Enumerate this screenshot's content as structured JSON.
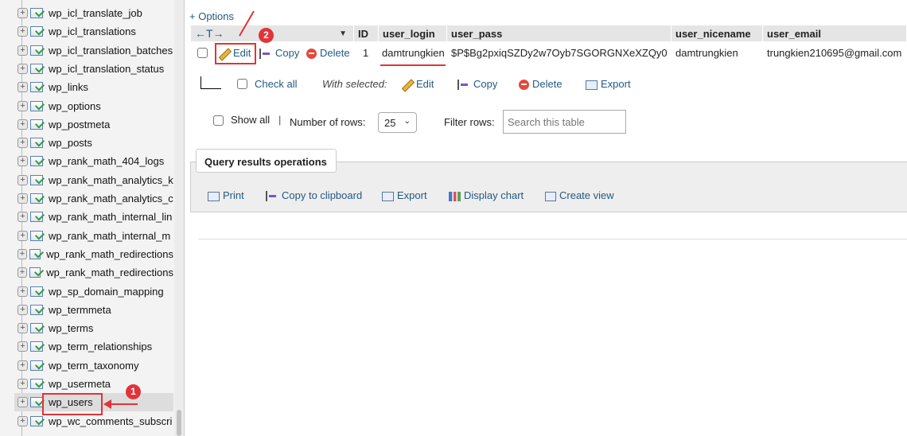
{
  "sidebar": {
    "items": [
      "wp_icl_translate_job",
      "wp_icl_translations",
      "wp_icl_translation_batches",
      "wp_icl_translation_status",
      "wp_links",
      "wp_options",
      "wp_postmeta",
      "wp_posts",
      "wp_rank_math_404_logs",
      "wp_rank_math_analytics_k",
      "wp_rank_math_analytics_c",
      "wp_rank_math_internal_lin",
      "wp_rank_math_internal_m",
      "wp_rank_math_redirections",
      "wp_rank_math_redirections",
      "wp_sp_domain_mapping",
      "wp_termmeta",
      "wp_terms",
      "wp_term_relationships",
      "wp_term_taxonomy",
      "wp_usermeta",
      "wp_users",
      "wp_wc_comments_subscri"
    ],
    "active": "wp_users"
  },
  "options_label": "+ Options",
  "table": {
    "columns": [
      "ID",
      "user_login",
      "user_pass",
      "user_nicename",
      "user_email"
    ],
    "rows": [
      {
        "edit": "Edit",
        "copy": "Copy",
        "delete": "Delete",
        "ID": "1",
        "user_login": "damtrungkien",
        "user_pass": "$P$Bg2pxiqSZDy2w7Oyb7SGORGNXeXZQy0",
        "user_nicename": "damtrungkien",
        "user_email": "trungkien210695@gmail.com"
      }
    ]
  },
  "bulk": {
    "check_all": "Check all",
    "with_selected": "With selected:",
    "edit": "Edit",
    "copy": "Copy",
    "delete": "Delete",
    "export": "Export"
  },
  "controls": {
    "show_all": "Show all",
    "number_of_rows_label": "Number of rows:",
    "rows_value": "25",
    "filter_label": "Filter rows:",
    "filter_placeholder": "Search this table"
  },
  "ops": {
    "title": "Query results operations",
    "print": "Print",
    "copy_clipboard": "Copy to clipboard",
    "export": "Export",
    "display_chart": "Display chart",
    "create_view": "Create view"
  },
  "annotations": {
    "step1": "1",
    "step2": "2"
  },
  "colors": {
    "accent": "#e0343a",
    "link": "#235a81"
  }
}
